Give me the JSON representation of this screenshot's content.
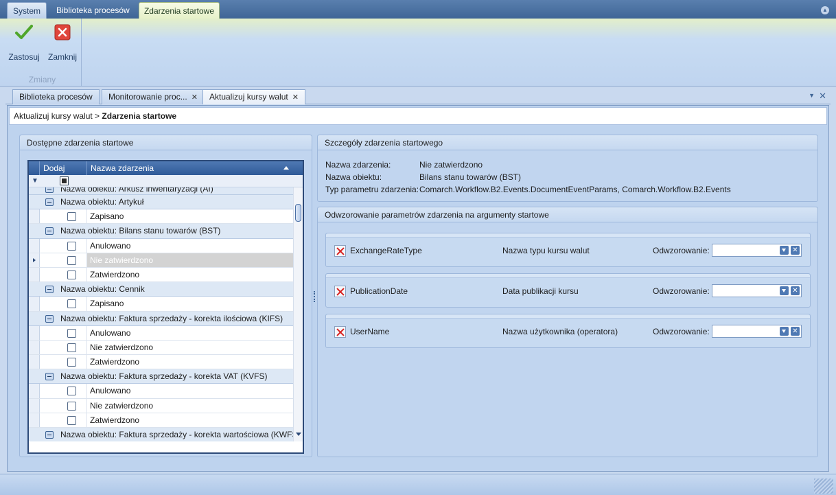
{
  "ribbon": {
    "tabs": [
      "System",
      "Biblioteka procesów",
      "Zdarzenia startowe"
    ],
    "buttons": {
      "apply": "Zastosuj",
      "close": "Zamknij"
    },
    "group_label": "Zmiany"
  },
  "doc_tabs": [
    {
      "label": "Biblioteka procesów"
    },
    {
      "label": "Monitorowanie proc..."
    },
    {
      "label": "Aktualizuj kursy walut"
    }
  ],
  "breadcrumb": {
    "parent": "Aktualizuj kursy walut",
    "separator": " > ",
    "current": "Zdarzenia startowe"
  },
  "left_panel": {
    "title": "Dostępne zdarzenia startowe",
    "columns": {
      "add": "Dodaj",
      "name": "Nazwa zdarzenia"
    },
    "rows": [
      {
        "type": "group",
        "text": "Nazwa obiektu: Arkusz inwentaryzacji (AI)"
      },
      {
        "type": "group",
        "text": "Nazwa obiektu: Artykuł"
      },
      {
        "type": "item",
        "text": "Zapisano"
      },
      {
        "type": "group",
        "text": "Nazwa obiektu: Bilans stanu towarów (BST)"
      },
      {
        "type": "item",
        "text": "Anulowano"
      },
      {
        "type": "item",
        "text": "Nie zatwierdzono",
        "selected": true
      },
      {
        "type": "item",
        "text": "Zatwierdzono"
      },
      {
        "type": "group",
        "text": "Nazwa obiektu: Cennik"
      },
      {
        "type": "item",
        "text": "Zapisano"
      },
      {
        "type": "group",
        "text": "Nazwa obiektu: Faktura sprzedaży - korekta ilościowa (KIFS)"
      },
      {
        "type": "item",
        "text": "Anulowano"
      },
      {
        "type": "item",
        "text": "Nie zatwierdzono"
      },
      {
        "type": "item",
        "text": "Zatwierdzono"
      },
      {
        "type": "group",
        "text": "Nazwa obiektu: Faktura sprzedaży - korekta VAT (KVFS)"
      },
      {
        "type": "item",
        "text": "Anulowano"
      },
      {
        "type": "item",
        "text": "Nie zatwierdzono"
      },
      {
        "type": "item",
        "text": "Zatwierdzono"
      },
      {
        "type": "group",
        "text": "Nazwa obiektu: Faktura sprzedaży - korekta wartościowa (KWFS)"
      }
    ]
  },
  "details": {
    "title": "Szczegóły zdarzenia startowego",
    "event_name_label": "Nazwa zdarzenia:",
    "event_name": "Nie zatwierdzono",
    "object_name_label": "Nazwa obiektu:",
    "object_name": "Bilans stanu towarów (BST)",
    "param_type_label": "Typ parametru zdarzenia:",
    "param_type": "Comarch.Workflow.B2.Events.DocumentEventParams, Comarch.Workflow.B2.Events"
  },
  "mapping": {
    "title": "Odwzorowanie parametrów zdarzenia na argumenty startowe",
    "mapping_label": "Odwzorowanie:",
    "params": [
      {
        "name": "ExchangeRateType",
        "description": "Nazwa typu kursu walut",
        "value": ""
      },
      {
        "name": "PublicationDate",
        "description": "Data publikacji kursu",
        "value": ""
      },
      {
        "name": "UserName",
        "description": "Nazwa użytkownika (operatora)",
        "value": ""
      }
    ]
  }
}
